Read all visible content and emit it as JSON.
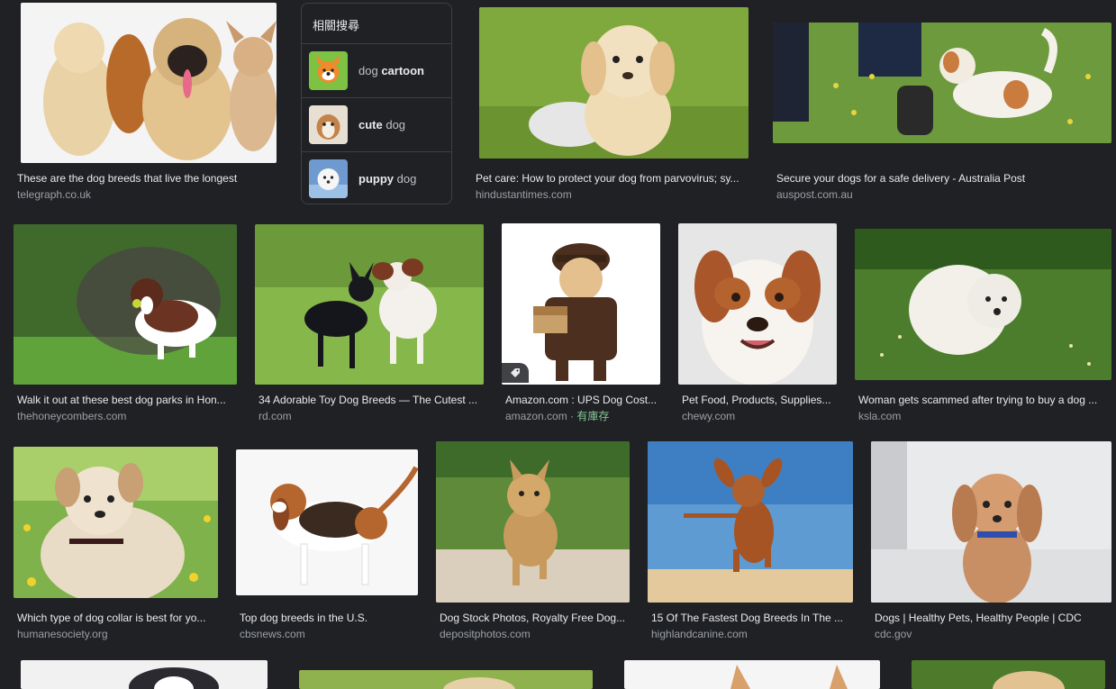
{
  "related": {
    "title": "相關搜尋",
    "items": [
      {
        "prefix": "dog ",
        "bold": "cartoon",
        "suffix": "",
        "icon": "dog-cartoon-thumb"
      },
      {
        "prefix": "",
        "bold": "cute",
        "suffix": " dog",
        "icon": "cute-dog-thumb"
      },
      {
        "prefix": "",
        "bold": "puppy",
        "suffix": " dog",
        "icon": "puppy-dog-thumb"
      }
    ]
  },
  "results": [
    {
      "caption": "These are the dog breeds that live the longest",
      "source": "telegraph.co.uk"
    },
    {
      "caption": "Pet care: How to protect your dog from parvovirus; sy...",
      "source": "hindustantimes.com"
    },
    {
      "caption": "Secure your dogs for a safe delivery - Australia Post",
      "source": "auspost.com.au"
    },
    {
      "caption": "Walk it out at these best dog parks in Hon...",
      "source": "thehoneycombers.com"
    },
    {
      "caption": "34 Adorable Toy Dog Breeds — The Cutest ...",
      "source": "rd.com"
    },
    {
      "caption": "Amazon.com : UPS Dog Cost...",
      "source": "amazon.com",
      "stock": "· 有庫存"
    },
    {
      "caption": "Pet Food, Products, Supplies...",
      "source": "chewy.com"
    },
    {
      "caption": "Woman gets scammed after trying to buy a dog ...",
      "source": "ksla.com"
    },
    {
      "caption": "Which type of dog collar is best for yo...",
      "source": "humanesociety.org"
    },
    {
      "caption": "Top dog breeds in the U.S.",
      "source": "cbsnews.com"
    },
    {
      "caption": "Dog Stock Photos, Royalty Free Dog...",
      "source": "depositphotos.com"
    },
    {
      "caption": "15 Of The Fastest Dog Breeds In The ...",
      "source": "highlandcanine.com"
    },
    {
      "caption": "Dogs | Healthy Pets, Healthy People | CDC",
      "source": "cdc.gov"
    }
  ]
}
